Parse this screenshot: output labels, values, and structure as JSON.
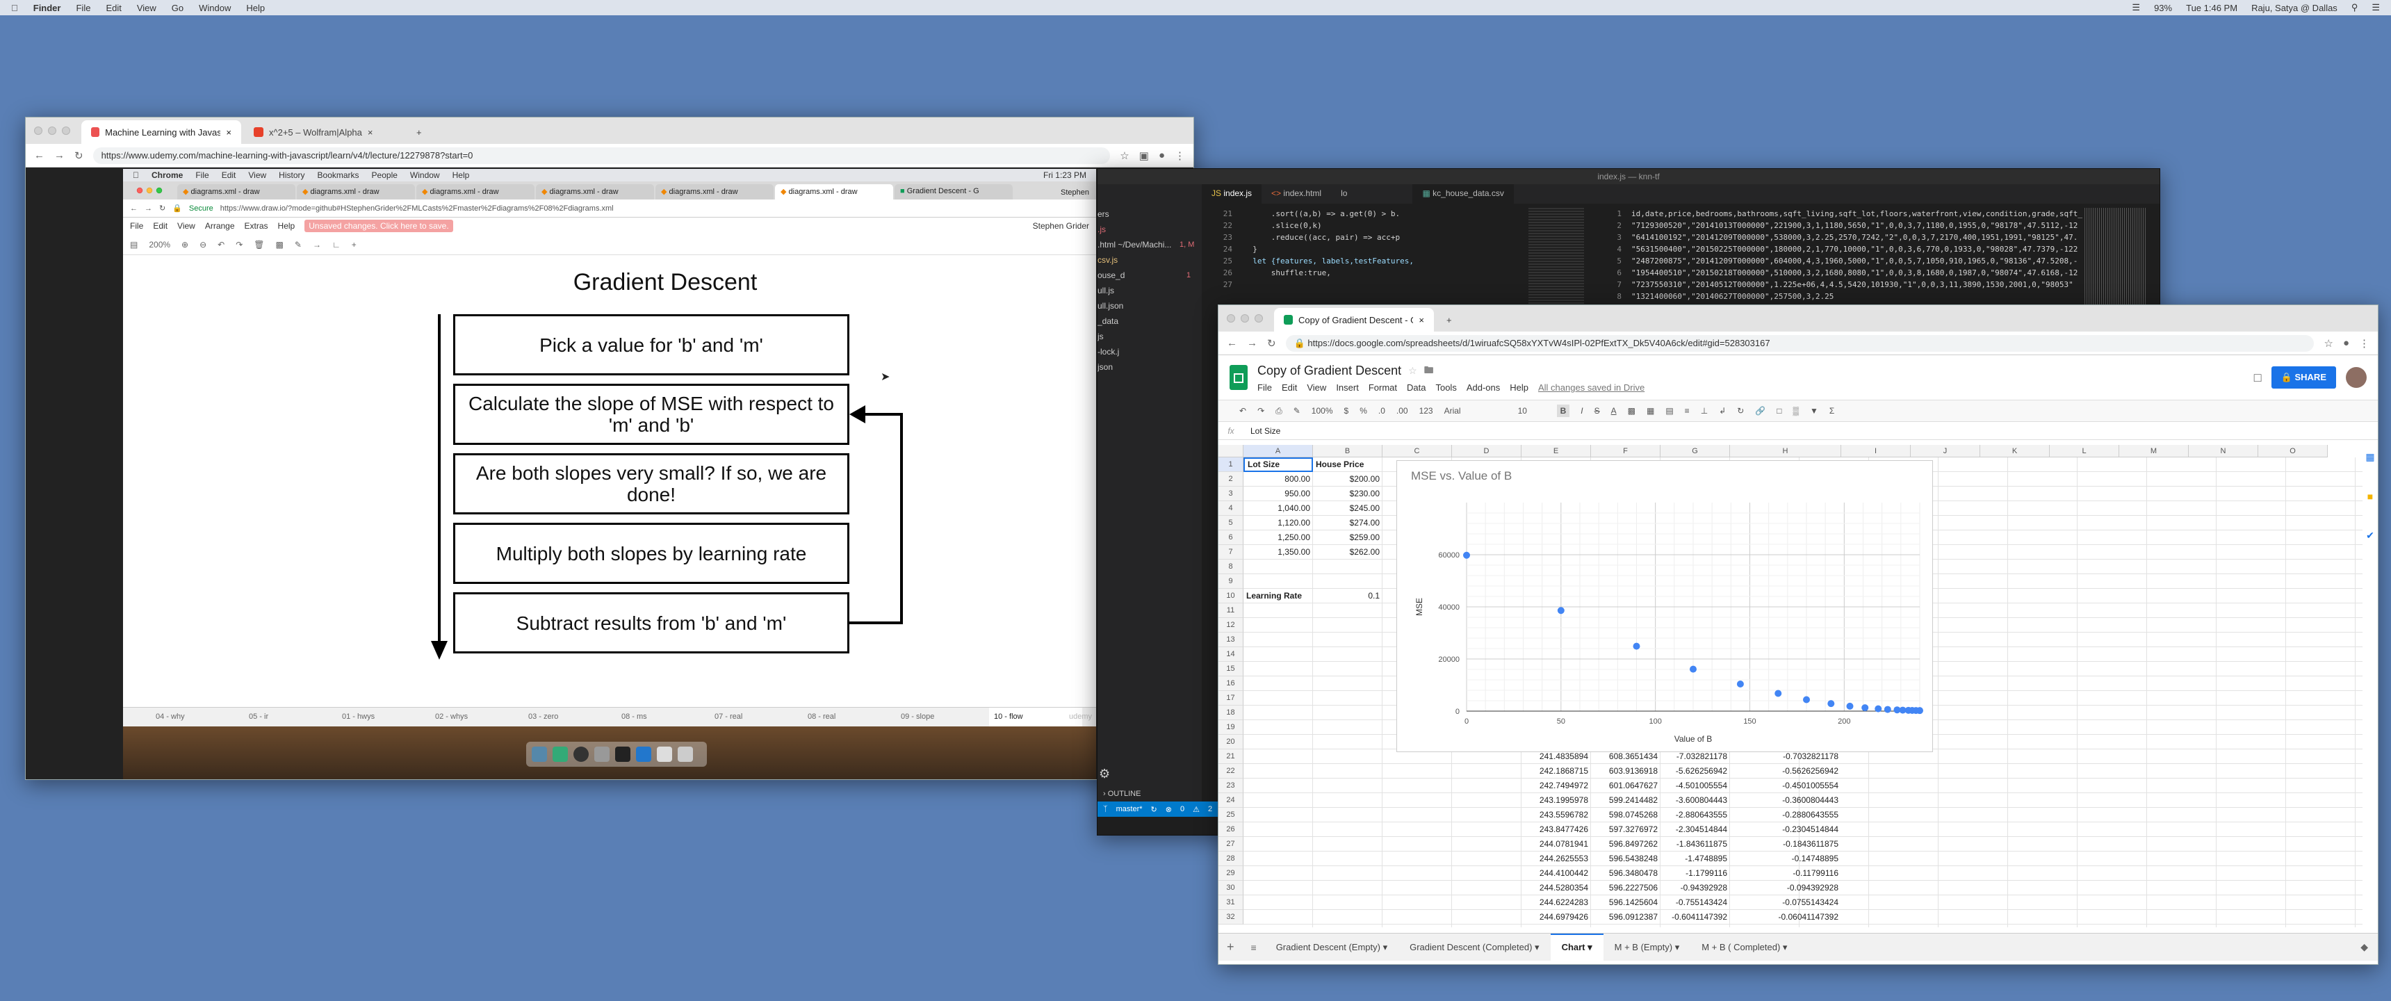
{
  "menubar": {
    "app": "Finder",
    "items": [
      "File",
      "Edit",
      "View",
      "Go",
      "Window",
      "Help"
    ],
    "battery": "93%",
    "clock": "Tue 1:46 PM",
    "user": "Raju, Satya @ Dallas"
  },
  "chrome_back": {
    "tabs": [
      "Machine Learning with Javascript",
      "x^2+5 – Wolfram|Alpha"
    ],
    "url": "https://www.udemy.com/machine-learning-with-javascript/learn/v4/t/lecture/12279878?start=0"
  },
  "inner_mac": {
    "app": "Chrome",
    "items": [
      "File",
      "Edit",
      "View",
      "History",
      "Bookmarks",
      "People",
      "Window",
      "Help"
    ],
    "clock": "Fri 1:23 PM"
  },
  "drawio_browser": {
    "tabs": [
      "diagrams.xml - draw",
      "diagrams.xml - draw",
      "diagrams.xml - draw",
      "diagrams.xml - draw",
      "diagrams.xml - draw",
      "diagrams.xml - draw",
      "Gradient Descent - G"
    ],
    "profile": "Stephen",
    "secure": "Secure",
    "url": "https://www.draw.io/?mode=github#HStephenGrider%2FMLCasts%2Fmaster%2Fdiagrams%2F08%2Fdiagrams.xml",
    "menu": [
      "File",
      "Edit",
      "View",
      "Arrange",
      "Extras",
      "Help"
    ],
    "unsaved": "Unsaved changes. Click here to save.",
    "user": "Stephen Grider",
    "zoom": "200%",
    "title": "Gradient Descent",
    "steps": [
      "Pick a value for 'b' and 'm'",
      "Calculate the slope of MSE with respect to 'm' and 'b'",
      "Are both slopes very small?  If so, we are done!",
      "Multiply both slopes by learning rate",
      "Subtract results from 'b' and 'm'"
    ],
    "page_tabs": [
      "04 - why",
      "05 - ir",
      "01 - hwys",
      "02 - whys",
      "03 - zero",
      "08 - ms",
      "07 - real",
      "08 - real",
      "09 - slope",
      "10 - flow"
    ],
    "dock_label": "udemy"
  },
  "vscode": {
    "title": "index.js — knn-tf",
    "tabs": [
      "index.js",
      "index.html",
      "lo",
      "kc_house_data.csv"
    ],
    "explorer": [
      "ers",
      ".js",
      ".html  ~/Dev/Machi...",
      "csv.js",
      "ouse_d",
      "ull.js",
      "ull.json",
      "_data",
      "js",
      "-lock.j",
      "json"
    ],
    "badges": [
      "1, M",
      "1"
    ],
    "line_nums": [
      "21",
      "22",
      "23",
      "24",
      "25",
      "26",
      "27"
    ],
    "code": [
      "      .sort((a,b) => a.get(0) > b.",
      "      .slice(0,k)",
      "      .reduce((acc, pair) => acc+p",
      "  }",
      "",
      "  let {features, labels,testFeatures,",
      "      shuffle:true,"
    ],
    "csv_nums": [
      "1",
      "2",
      "3",
      "4",
      "5",
      "6",
      "7",
      "8"
    ],
    "csv": [
      "id,date,price,bedrooms,bathrooms,sqft_living,sqft_lot,floors,waterfront,view,condition,grade,sqft_",
      "\"7129300520\",\"20141013T000000\",221900,3,1,1180,5650,\"1\",0,0,3,7,1180,0,1955,0,\"98178\",47.5112,-12",
      "\"6414100192\",\"20141209T000000\",538000,3,2.25,2570,7242,\"2\",0,0,3,7,2170,400,1951,1991,\"98125\",47.",
      "\"5631500400\",\"20150225T000000\",180000,2,1,770,10000,\"1\",0,0,3,6,770,0,1933,0,\"98028\",47.7379,-122",
      "\"2487200875\",\"20141209T000000\",604000,4,3,1960,5000,\"1\",0,0,5,7,1050,910,1965,0,\"98136\",47.5208,-",
      "\"1954400510\",\"20150218T000000\",510000,3,2,1680,8080,\"1\",0,0,3,8,1680,0,1987,0,\"98074\",47.6168,-12",
      "\"7237550310\",\"20140512T000000\",1.225e+06,4,4.5,5420,101930,\"1\",0,0,3,11,3890,1530,2001,0,\"98053\"",
      "\"1321400060\",\"20140627T000000\",257500,3,2.25"
    ],
    "status": [
      "master*",
      "0",
      "2",
      "0"
    ],
    "outline": "OUTLINE"
  },
  "sheets_browser": {
    "tab": "Copy of Gradient Descent - Go",
    "url": "https://docs.google.com/spreadsheets/d/1wiruafcSQ58xYXTvW4sIPl-02PfExtTX_Dk5V40A6ck/edit#gid=528303167",
    "doc_title": "Copy of Gradient Descent",
    "menu": [
      "File",
      "Edit",
      "View",
      "Insert",
      "Format",
      "Data",
      "Tools",
      "Add-ons",
      "Help"
    ],
    "saved": "All changes saved in Drive",
    "share": "SHARE",
    "toolbar": {
      "zoom": "100%",
      "currency": "$",
      "percent": "%",
      "dec0": ".0",
      "dec00": ".00",
      "fmt": "123",
      "font": "Arial",
      "size": "10"
    },
    "formula_ref": "fx",
    "formula": "Lot Size",
    "columns": [
      "A",
      "B",
      "C",
      "D",
      "E",
      "F",
      "G",
      "H",
      "I",
      "J",
      "K",
      "L",
      "M",
      "N",
      "O"
    ],
    "rows": [
      "1",
      "2",
      "3",
      "4",
      "5",
      "6",
      "7",
      "8",
      "9",
      "10",
      "11",
      "12",
      "13",
      "14",
      "15",
      "16",
      "17",
      "18",
      "19",
      "20",
      "21",
      "22",
      "23",
      "24",
      "25",
      "26",
      "27",
      "28",
      "29",
      "30",
      "31",
      "32"
    ],
    "headers": {
      "a": "Lot Size",
      "b": "House Price"
    },
    "data": [
      [
        "800.00",
        "$200.00"
      ],
      [
        "950.00",
        "$230.00"
      ],
      [
        "1,040.00",
        "$245.00"
      ],
      [
        "1,120.00",
        "$274.00"
      ],
      [
        "1,250.00",
        "$259.00"
      ],
      [
        "1,350.00",
        "$262.00"
      ]
    ],
    "lr_label": "Learning Rate",
    "lr_value": "0.1",
    "lower_rows": [
      [
        "241.4835894",
        "608.3651434",
        "-7.032821178",
        "-0.7032821178"
      ],
      [
        "242.1868715",
        "603.9136918",
        "-5.626256942",
        "-0.5626256942"
      ],
      [
        "242.7494972",
        "601.0647627",
        "-4.501005554",
        "-0.4501005554"
      ],
      [
        "243.1995978",
        "599.2414482",
        "-3.600804443",
        "-0.3600804443"
      ],
      [
        "243.5596782",
        "598.0745268",
        "-2.880643555",
        "-0.2880643555"
      ],
      [
        "243.8477426",
        "597.3276972",
        "-2.304514844",
        "-0.2304514844"
      ],
      [
        "244.0781941",
        "596.8497262",
        "-1.843611875",
        "-0.1843611875"
      ],
      [
        "244.2625553",
        "596.5438248",
        "-1.4748895",
        "-0.14748895"
      ],
      [
        "244.4100442",
        "596.3480478",
        "-1.1799116",
        "-0.11799116"
      ],
      [
        "244.5280354",
        "596.2227506",
        "-0.94392928",
        "-0.094392928"
      ],
      [
        "244.6224283",
        "596.1425604",
        "-0.755143424",
        "-0.0755143424"
      ],
      [
        "244.6979426",
        "596.0912387",
        "-0.6041147392",
        "-0.06041147392"
      ]
    ],
    "sheet_tabs": [
      "Gradient Descent (Empty)",
      "Gradient Descent (Completed)",
      "Chart",
      "M + B (Empty)",
      "M + B ( Completed)"
    ],
    "active_tab": "Chart"
  },
  "chart_data": {
    "type": "scatter",
    "title": "MSE vs. Value of B",
    "xlabel": "Value of B",
    "ylabel": "MSE",
    "xlim": [
      0,
      240
    ],
    "ylim": [
      0,
      80000
    ],
    "xticks": [
      0,
      50,
      100,
      150,
      200
    ],
    "yticks": [
      0,
      20000,
      40000,
      60000
    ],
    "grid": true,
    "color": "#4285f4",
    "x": [
      0,
      50,
      90,
      120,
      145,
      165,
      180,
      193,
      203,
      211,
      218,
      223,
      228,
      231,
      234,
      236,
      238,
      240
    ],
    "y": [
      59800,
      38600,
      24900,
      16100,
      10400,
      6800,
      4400,
      2900,
      1900,
      1300,
      900,
      650,
      480,
      380,
      310,
      270,
      240,
      220
    ]
  }
}
